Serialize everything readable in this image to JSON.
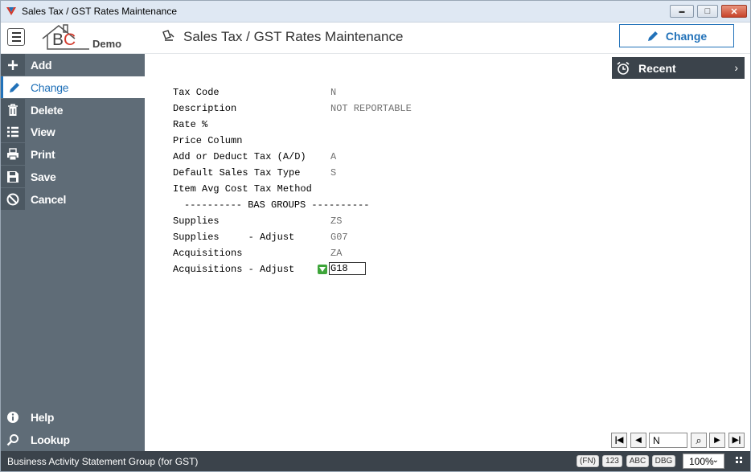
{
  "window": {
    "title": "Sales Tax / GST Rates Maintenance",
    "min_glyph": "▬",
    "max_glyph": "□",
    "close_glyph": "✕"
  },
  "header": {
    "logo_text_b": "B",
    "logo_text_c": "C",
    "logo_demo": "Demo",
    "page_title": "Sales Tax / GST Rates Maintenance",
    "change_button": "Change"
  },
  "sidebar": {
    "items": [
      {
        "label": "Add",
        "icon": "plus-icon"
      },
      {
        "label": "Change",
        "icon": "pencil-icon"
      },
      {
        "label": "Delete",
        "icon": "trash-icon"
      },
      {
        "label": "View",
        "icon": "list-icon"
      },
      {
        "label": "Print",
        "icon": "printer-icon"
      },
      {
        "label": "Save",
        "icon": "floppy-icon"
      },
      {
        "label": "Cancel",
        "icon": "cancel-icon"
      }
    ],
    "bottom": [
      {
        "label": "Help",
        "icon": "info-icon"
      },
      {
        "label": "Lookup",
        "icon": "search-icon"
      }
    ]
  },
  "recent": {
    "label": "Recent",
    "chevron": "›"
  },
  "form": {
    "tax_code": {
      "label": "Tax Code",
      "value": "N"
    },
    "description": {
      "label": "Description",
      "value": "NOT REPORTABLE"
    },
    "rate": {
      "label": "Rate %",
      "value": ""
    },
    "price_column": {
      "label": "Price Column",
      "value": ""
    },
    "add_deduct": {
      "label": "Add or Deduct Tax (A/D)",
      "value": "A"
    },
    "default_type": {
      "label": "Default Sales Tax Type",
      "value": "S"
    },
    "avg_cost": {
      "label": "Item Avg Cost Tax Method",
      "value": ""
    },
    "bas_header": "---------- BAS GROUPS ----------",
    "supplies": {
      "label": "Supplies",
      "value": "ZS"
    },
    "supplies_adjust": {
      "label": "Supplies     - Adjust",
      "value": "G07"
    },
    "acquisitions": {
      "label": "Acquisitions",
      "value": "ZA"
    },
    "acquisitions_adjust": {
      "label": "Acquisitions - Adjust",
      "value": "G18"
    }
  },
  "nav": {
    "first": "|◀",
    "prev": "◀",
    "key_value": "N",
    "search": "⌕",
    "next": "▶",
    "last": "▶|"
  },
  "status": {
    "text": "Business Activity Statement Group (for GST)",
    "fn": "(FN)",
    "num": "123",
    "abc": "ABC",
    "dbg": "DBG",
    "zoom": "100%",
    "zoom_chevron": "⌄"
  },
  "colors": {
    "accent": "#2272b9",
    "sidebar": "#5f6c77",
    "statusbar": "#3b434b"
  }
}
